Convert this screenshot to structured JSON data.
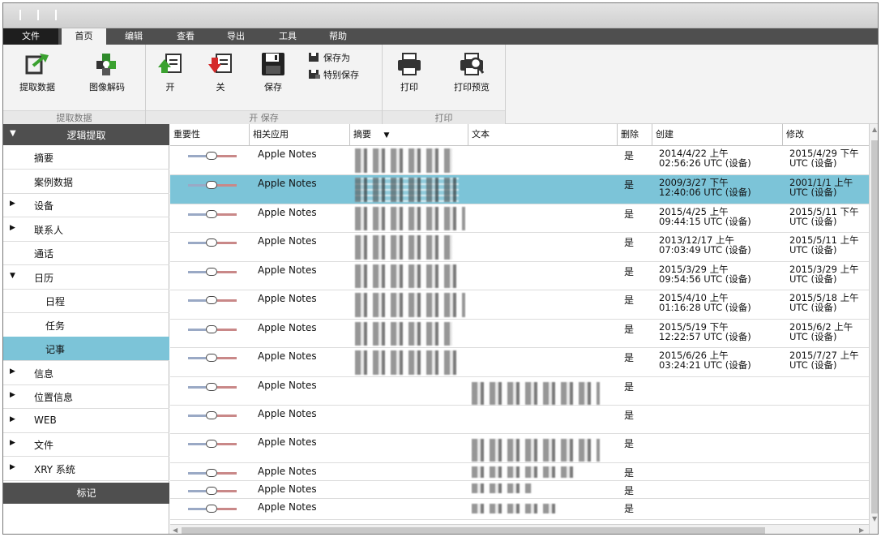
{
  "menu": {
    "file": "文件",
    "home": "首页",
    "edit": "编辑",
    "view": "查看",
    "export": "导出",
    "tools": "工具",
    "help": "帮助"
  },
  "ribbon": {
    "extract_group": {
      "label": "提取数据",
      "extract_btn": "提取数据",
      "decode_btn": "图像解码"
    },
    "open_save_group": {
      "label": "开 保存",
      "open_btn": "开",
      "close_btn": "关",
      "save_btn": "保存",
      "save_as": "保存为",
      "special_save": "特别保存"
    },
    "print_group": {
      "label": "打印",
      "print_btn": "打印",
      "preview_btn": "打印预览"
    }
  },
  "sidebar": {
    "header": "逻辑提取",
    "items": [
      {
        "label": "摘要",
        "arrow": ""
      },
      {
        "label": "案例数据",
        "arrow": ""
      },
      {
        "label": "设备",
        "arrow": "▶"
      },
      {
        "label": "联系人",
        "arrow": "▶"
      },
      {
        "label": "通话",
        "arrow": ""
      },
      {
        "label": "日历",
        "arrow": "▼"
      },
      {
        "label": "日程",
        "arrow": ""
      },
      {
        "label": "任务",
        "arrow": ""
      },
      {
        "label": "记事",
        "arrow": ""
      },
      {
        "label": "信息",
        "arrow": "▶"
      },
      {
        "label": "位置信息",
        "arrow": "▶"
      },
      {
        "label": "WEB",
        "arrow": "▶"
      },
      {
        "label": "文件",
        "arrow": "▶"
      },
      {
        "label": "XRY 系统",
        "arrow": "▶"
      }
    ],
    "footer": "标记"
  },
  "grid": {
    "headers": {
      "importance": "重要性",
      "app": "相关应用",
      "summary": "摘要",
      "text": "文本",
      "deleted": "删除",
      "created": "创建",
      "modified": "修改"
    },
    "rows": [
      {
        "app": "Apple Notes",
        "deleted": "是",
        "created_1": "2014/4/22 上午",
        "created_2": "02:56:26 UTC (设备)",
        "modified_1": "2015/4/29 下午",
        "modified_2": "UTC (设备)"
      },
      {
        "app": "Apple Notes",
        "deleted": "是",
        "created_1": "2009/3/27 下午",
        "created_2": "12:40:06 UTC (设备)",
        "modified_1": "2001/1/1 上午",
        "modified_2": "UTC (设备)"
      },
      {
        "app": "Apple Notes",
        "deleted": "是",
        "created_1": "2015/4/25 上午",
        "created_2": "09:44:15 UTC (设备)",
        "modified_1": "2015/5/11 下午",
        "modified_2": "UTC (设备)"
      },
      {
        "app": "Apple Notes",
        "deleted": "是",
        "created_1": "2013/12/17 上午",
        "created_2": "07:03:49 UTC (设备)",
        "modified_1": "2015/5/11 上午",
        "modified_2": "UTC (设备)"
      },
      {
        "app": "Apple Notes",
        "deleted": "是",
        "created_1": "2015/3/29 上午",
        "created_2": "09:54:56 UTC (设备)",
        "modified_1": "2015/3/29 上午",
        "modified_2": "UTC (设备)"
      },
      {
        "app": "Apple Notes",
        "deleted": "是",
        "created_1": "2015/4/10 上午",
        "created_2": "01:16:28 UTC (设备)",
        "modified_1": "2015/5/18 上午",
        "modified_2": "UTC (设备)"
      },
      {
        "app": "Apple Notes",
        "deleted": "是",
        "created_1": "2015/5/19 下午",
        "created_2": "12:22:57 UTC (设备)",
        "modified_1": "2015/6/2 上午",
        "modified_2": "UTC (设备)"
      },
      {
        "app": "Apple Notes",
        "deleted": "是",
        "created_1": "2015/6/26 上午",
        "created_2": "03:24:21 UTC (设备)",
        "modified_1": "2015/7/27 上午",
        "modified_2": "UTC (设备)"
      },
      {
        "app": "Apple Notes",
        "deleted": "是"
      },
      {
        "app": "Apple Notes",
        "deleted": "是"
      },
      {
        "app": "Apple Notes",
        "deleted": "是"
      },
      {
        "app": "Apple Notes",
        "deleted": "是"
      },
      {
        "app": "Apple Notes",
        "deleted": "是"
      },
      {
        "app": "Apple Notes",
        "deleted": "是"
      }
    ]
  },
  "colors": {
    "accent": "#7cc4d8",
    "dark_bar": "#4f4f4f",
    "ribbon_bg": "#f3f3f3"
  }
}
